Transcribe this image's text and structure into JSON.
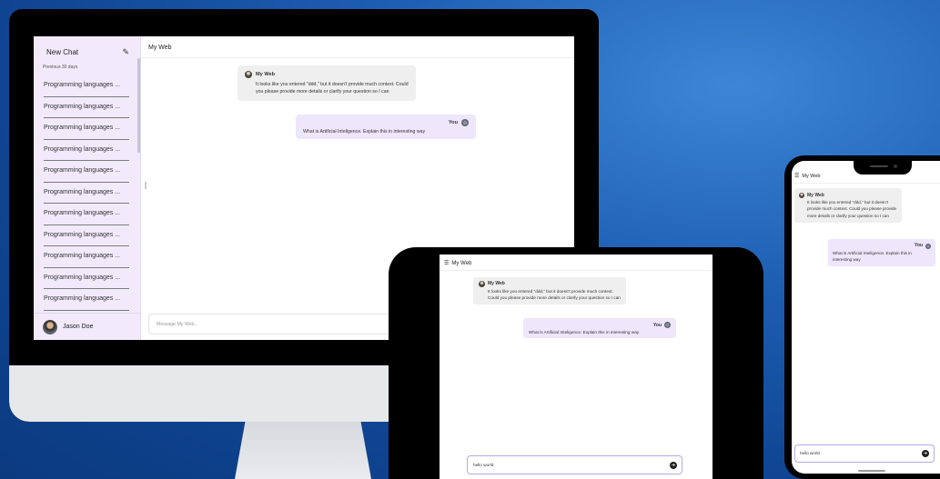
{
  "desktop": {
    "sidebar": {
      "new_chat_label": "New Chat",
      "new_chat_icon": "edit-icon",
      "section_label": "Previous 30 days",
      "items": [
        "Programming languages ...",
        "Programming languages ...",
        "Programming languages ...",
        "Programming languages ...",
        "Programming languages ...",
        "Programming languages ...",
        "Programming languages ...",
        "Programming languages ...",
        "Programming languages ...",
        "Programming languages ...",
        "Programming languages ..."
      ],
      "user_name": "Jason Doe"
    },
    "header_title": "My Web",
    "messages": {
      "bot_name": "My Web",
      "bot_text": "It looks like you entered \"ddd,\" but it doesn't provide much context. Could you please provide more details or clarify your question so I can",
      "user_name": "You",
      "user_text": "What is Artificial Inteligence. Explain this in interesting way"
    },
    "input_placeholder": "Message My Web..."
  },
  "tablet": {
    "header_title": "My Web",
    "bot_name": "My Web",
    "bot_text": "It looks like you entered \"ddd,\" but it doesn't provide much context. Could you please provide more details or clarify your question so I can",
    "user_name": "You",
    "user_text": "What is Artificial Inteligence. Explain this in interesting way",
    "input_value": "hello world"
  },
  "phone": {
    "header_title": "My Web",
    "bot_name": "My Web",
    "bot_text": "It looks like you entered \"ddd,\" but it doesn't provide much context. Could you please provide more details or clarify your question so I can",
    "user_name": "You",
    "user_text": "What is Artificial Inteligence. Explain this in interesting way",
    "input_value": "hello world"
  },
  "colors": {
    "background": "#1e5fb4",
    "sidebar": "#f2e9fb",
    "user_bubble": "#eee6fb",
    "bot_bubble": "#efefef",
    "input_border": "#b8a9e6"
  }
}
